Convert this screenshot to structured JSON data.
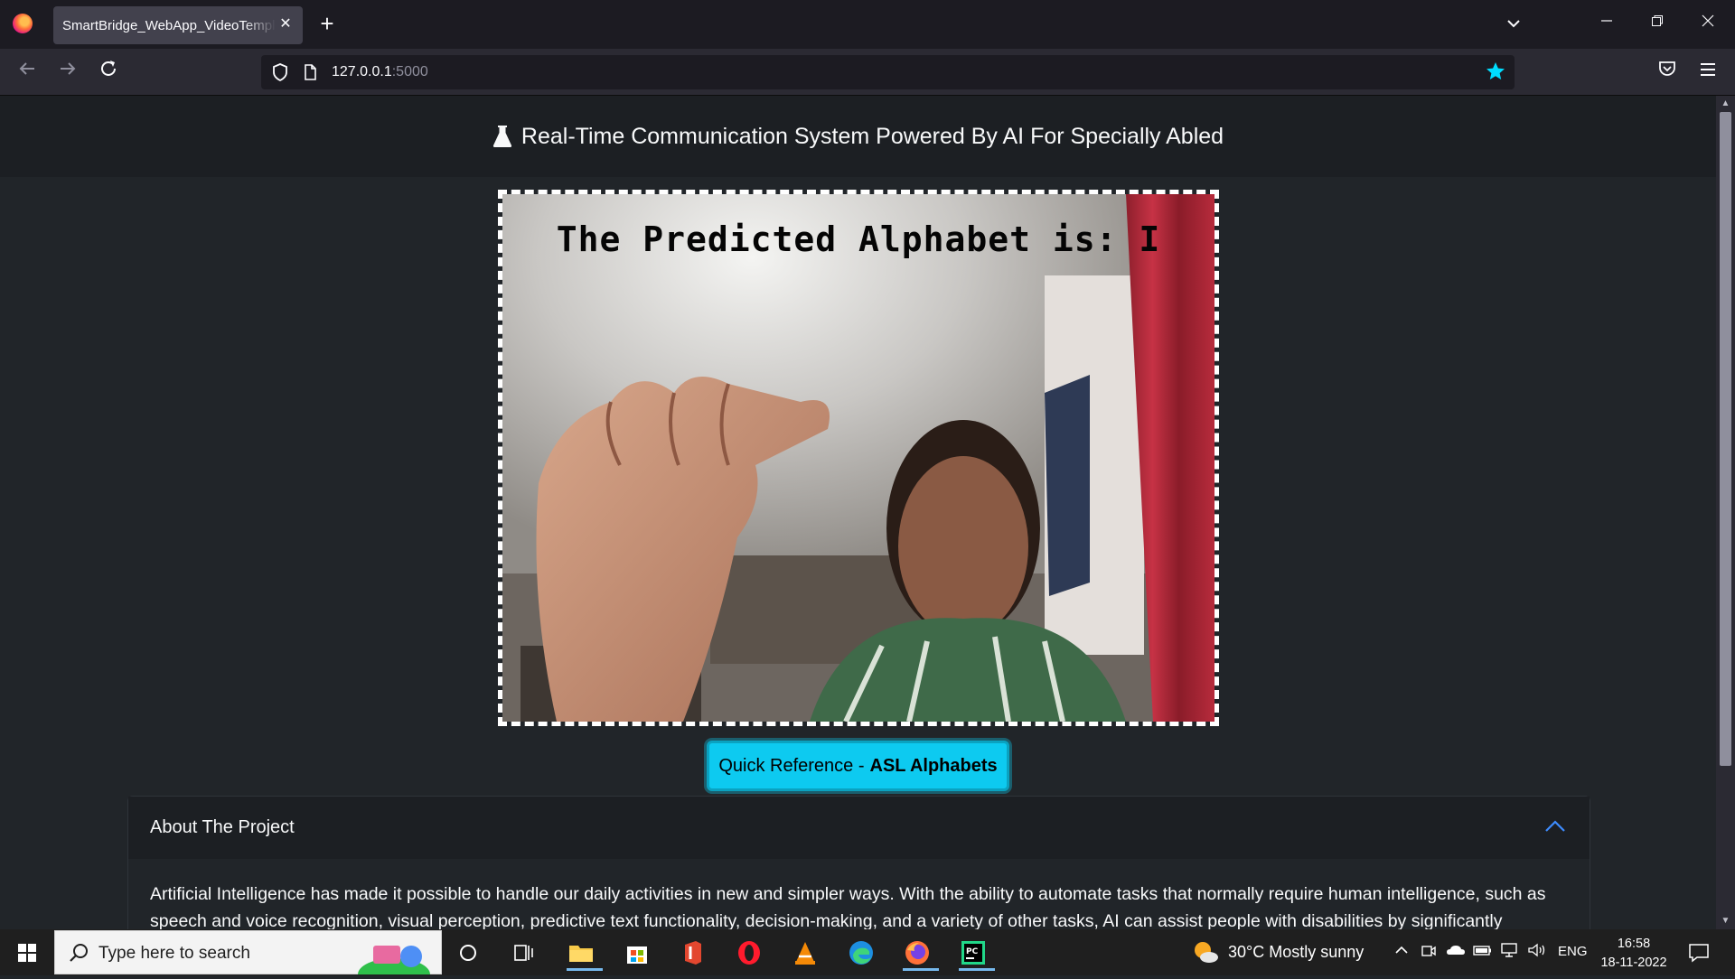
{
  "browser": {
    "tab_title": "SmartBridge_WebApp_VideoTemplate",
    "tab_close": "✕",
    "new_tab": "+",
    "url_host": "127.0.0.1",
    "url_port": ":5000",
    "accent_color": "#00ddff"
  },
  "page": {
    "title": "Real-Time Communication System Powered By AI For Specially Abled",
    "video_overlay_text": "The Predicted Alphabet is: I",
    "reference_button": {
      "prefix": "Quick Reference - ",
      "bold": "ASL Alphabets"
    },
    "reference_button_color": "#0dcaf0",
    "accordion": {
      "title": "About The Project",
      "expanded": true,
      "body": "Artificial Intelligence has made it possible to handle our daily activities in new and simpler ways. With the ability to automate tasks that normally require human intelligence, such as speech and voice recognition, visual perception, predictive text functionality, decision-making, and a variety of other tasks, AI can assist people with disabilities by significantly"
    }
  },
  "taskbar": {
    "search_placeholder": "Type here to search",
    "weather": "30°C  Mostly sunny",
    "language": "ENG",
    "time": "16:58",
    "date": "18-11-2022",
    "pinned_apps": [
      "cortana-icon",
      "task-view-icon",
      "file-explorer-icon",
      "microsoft-store-icon",
      "office-icon",
      "opera-icon",
      "vlc-icon",
      "edge-icon",
      "firefox-icon",
      "pycharm-icon"
    ]
  }
}
